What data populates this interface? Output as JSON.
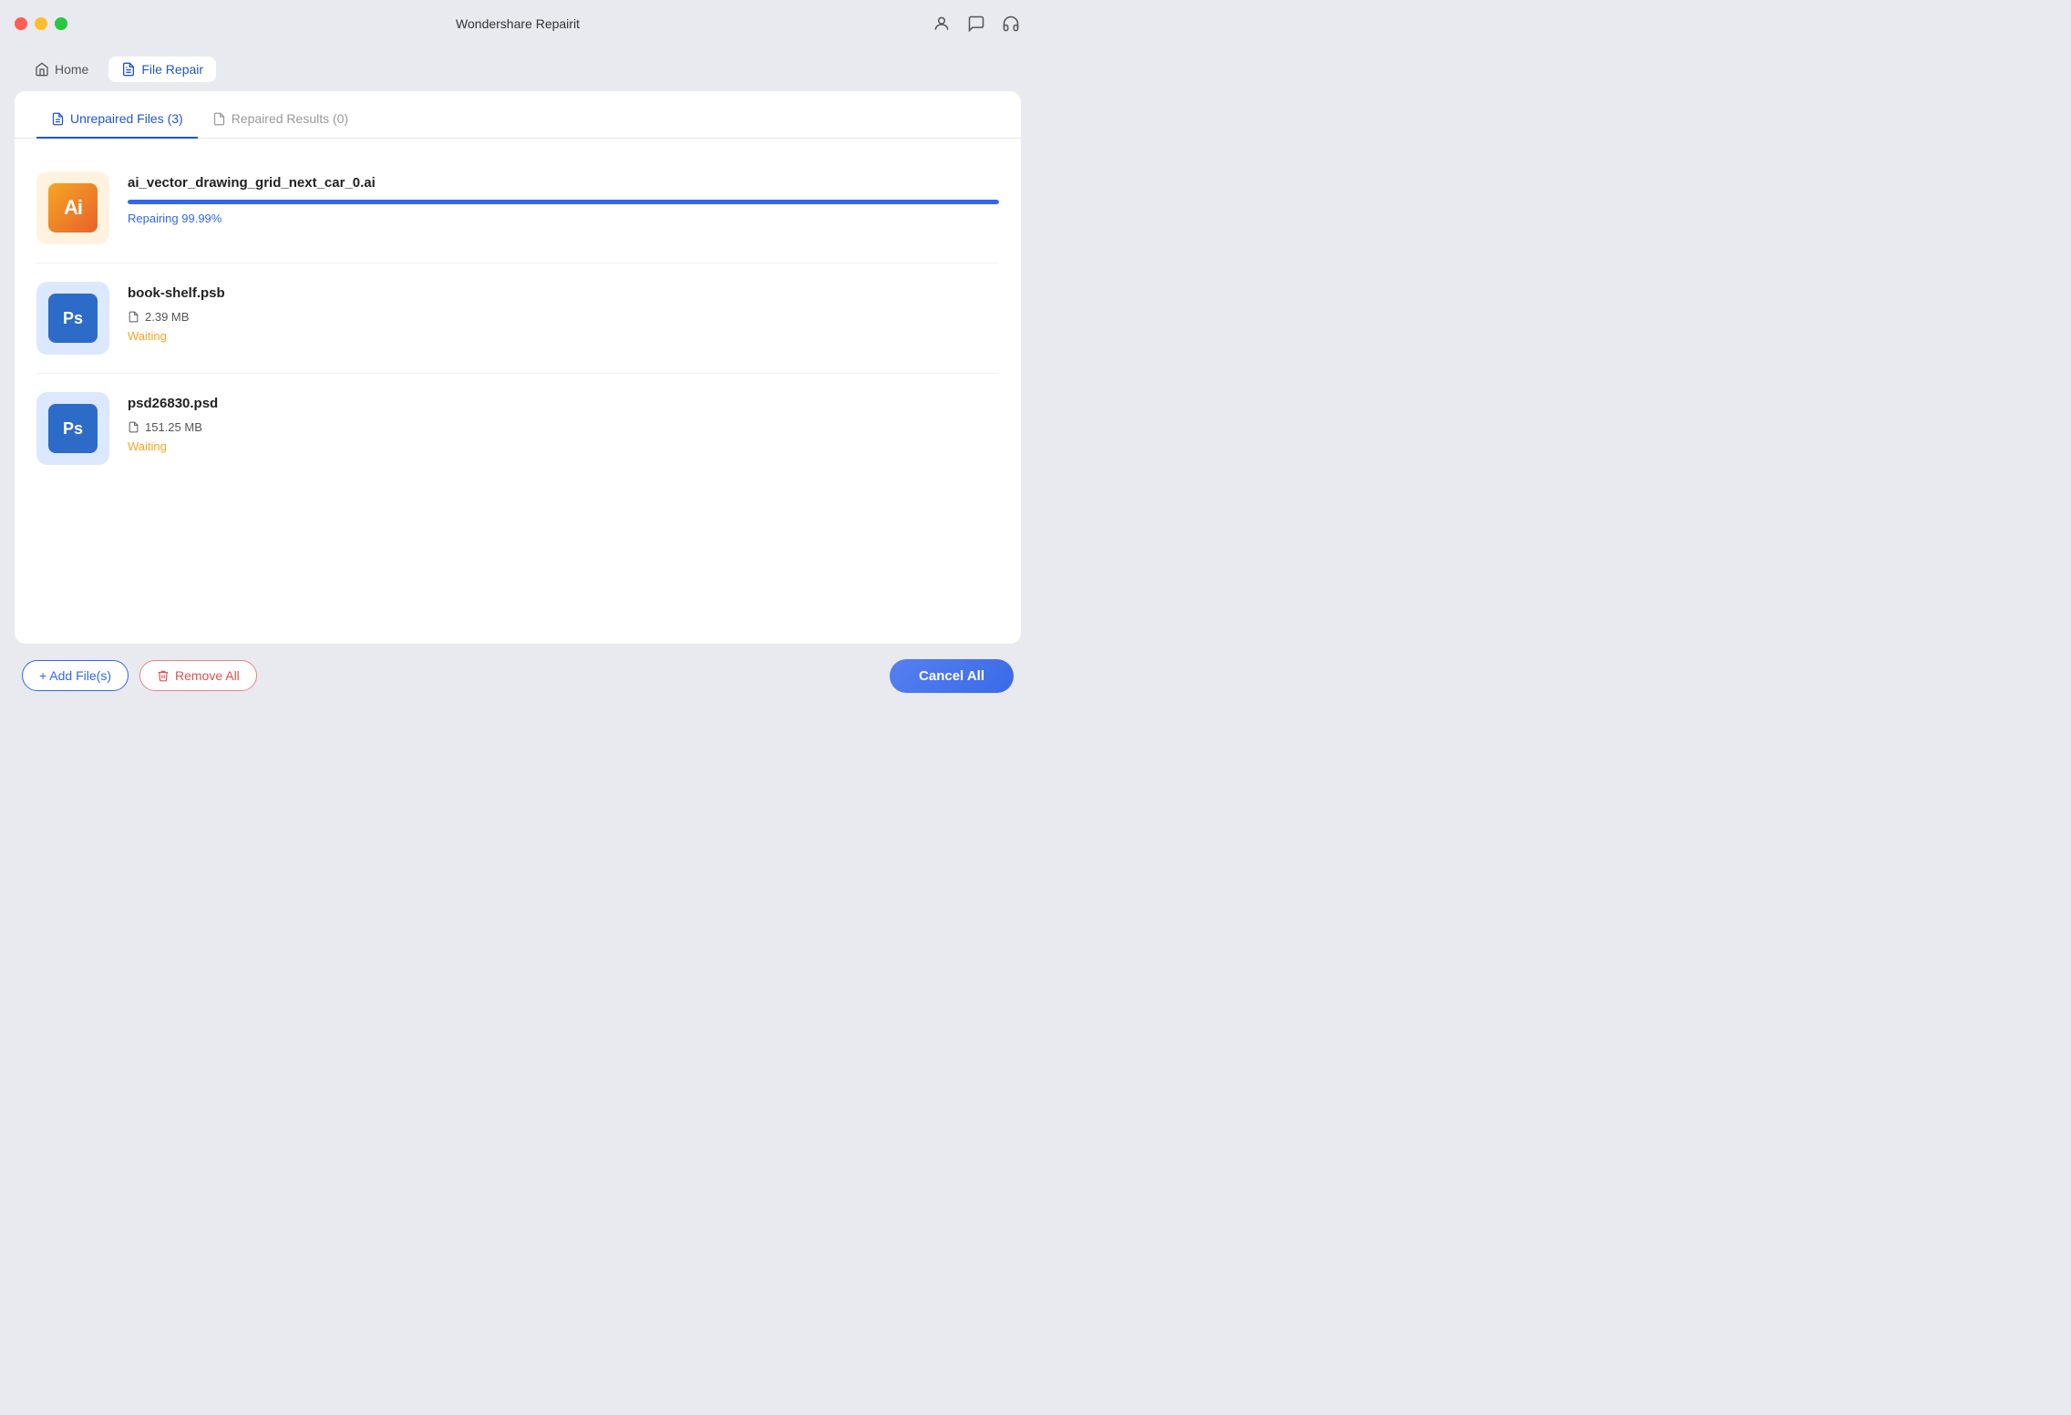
{
  "app": {
    "title": "Wondershare Repairit"
  },
  "nav": {
    "home_label": "Home",
    "file_repair_label": "File Repair"
  },
  "tabs": {
    "unrepaired_label": "Unrepaired Files (3)",
    "repaired_label": "Repaired Results (0)"
  },
  "files": [
    {
      "id": "file-1",
      "name": "ai_vector_drawing_grid_next_car_0.ai",
      "type": "ai",
      "size": null,
      "status": "Repairing 99.99%",
      "status_type": "repairing",
      "progress": 99.99
    },
    {
      "id": "file-2",
      "name": "book-shelf.psb",
      "type": "ps",
      "size": "2.39 MB",
      "status": "Waiting",
      "status_type": "waiting",
      "progress": 0
    },
    {
      "id": "file-3",
      "name": "psd26830.psd",
      "type": "ps",
      "size": "151.25 MB",
      "status": "Waiting",
      "status_type": "waiting",
      "progress": 0
    }
  ],
  "buttons": {
    "add_files": "+ Add File(s)",
    "remove_all": "Remove All",
    "cancel_all": "Cancel All"
  },
  "colors": {
    "accent": "#3366ee",
    "waiting": "#f5a623",
    "repairing": "#3366ee"
  }
}
